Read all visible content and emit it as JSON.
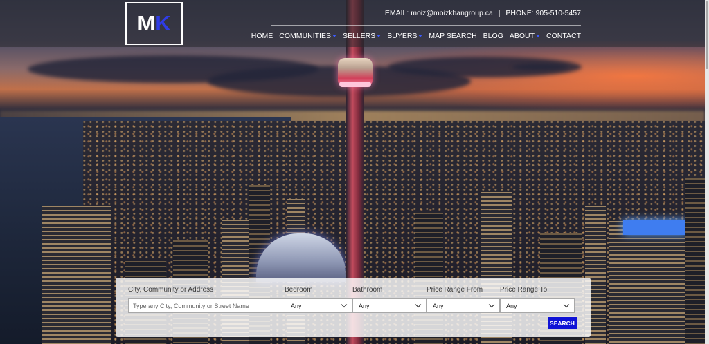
{
  "brand": {
    "logo_m": "M",
    "logo_k": "K",
    "accent": "#2f3ce6"
  },
  "header": {
    "email": "EMAIL: moiz@moizkhangroup.ca",
    "separator": "|",
    "phone": "PHONE: 905-510-5457"
  },
  "nav": {
    "items": [
      {
        "label": "HOME",
        "dropdown": false
      },
      {
        "label": "COMMUNITIES",
        "dropdown": true
      },
      {
        "label": "SELLERS",
        "dropdown": true
      },
      {
        "label": "BUYERS",
        "dropdown": true
      },
      {
        "label": "MAP SEARCH",
        "dropdown": false
      },
      {
        "label": "BLOG",
        "dropdown": false
      },
      {
        "label": "ABOUT",
        "dropdown": true
      },
      {
        "label": "CONTACT",
        "dropdown": false
      }
    ]
  },
  "search": {
    "location_label": "City, Community or Address",
    "location_placeholder": "Type any City, Community or Street Name",
    "bedroom_label": "Bedroom",
    "bedroom_value": "Any",
    "bathroom_label": "Bathroom",
    "bathroom_value": "Any",
    "price_from_label": "Price Range From",
    "price_from_value": "Any",
    "price_to_label": "Price Range To",
    "price_to_value": "Any",
    "button_label": "SEARCH",
    "button_color": "#0f12d6"
  }
}
